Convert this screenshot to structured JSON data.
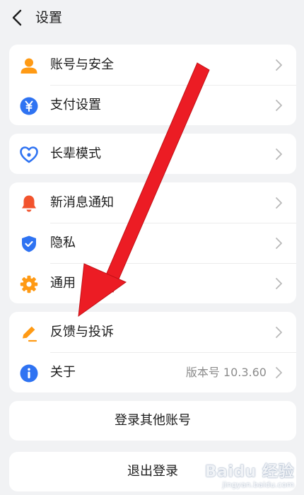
{
  "header": {
    "title": "设置",
    "back_icon": "chevron-left-icon"
  },
  "groups": {
    "account": {
      "items": [
        {
          "label": "账号与安全",
          "icon": "user-icon",
          "icon_color": "#ff9a14"
        },
        {
          "label": "支付设置",
          "icon": "yuan-icon",
          "icon_color": "#2f73f2"
        }
      ]
    },
    "elder": {
      "items": [
        {
          "label": "长辈模式",
          "icon": "heart-icon",
          "icon_color": "#2f73f2"
        }
      ]
    },
    "general": {
      "items": [
        {
          "label": "新消息通知",
          "icon": "bell-icon",
          "icon_color": "#f2532d"
        },
        {
          "label": "隐私",
          "icon": "shield-check-icon",
          "icon_color": "#2f73f2"
        },
        {
          "label": "通用",
          "icon": "gear-icon",
          "icon_color": "#ff9a14"
        }
      ]
    },
    "about": {
      "items": [
        {
          "label": "反馈与投诉",
          "icon": "pencil-icon",
          "icon_color": "#ff9a14"
        },
        {
          "label": "关于",
          "icon": "info-icon",
          "icon_color": "#2f73f2",
          "value": "版本号 10.3.60"
        }
      ]
    }
  },
  "actions": {
    "switch_account": "登录其他账号",
    "logout": "退出登录"
  },
  "annotation": {
    "type": "red-arrow",
    "color": "#ec1c24",
    "points_to": "反馈与投诉"
  },
  "watermark": {
    "logo": "Baidu 经验",
    "site": "jingyan.baidu.com"
  }
}
